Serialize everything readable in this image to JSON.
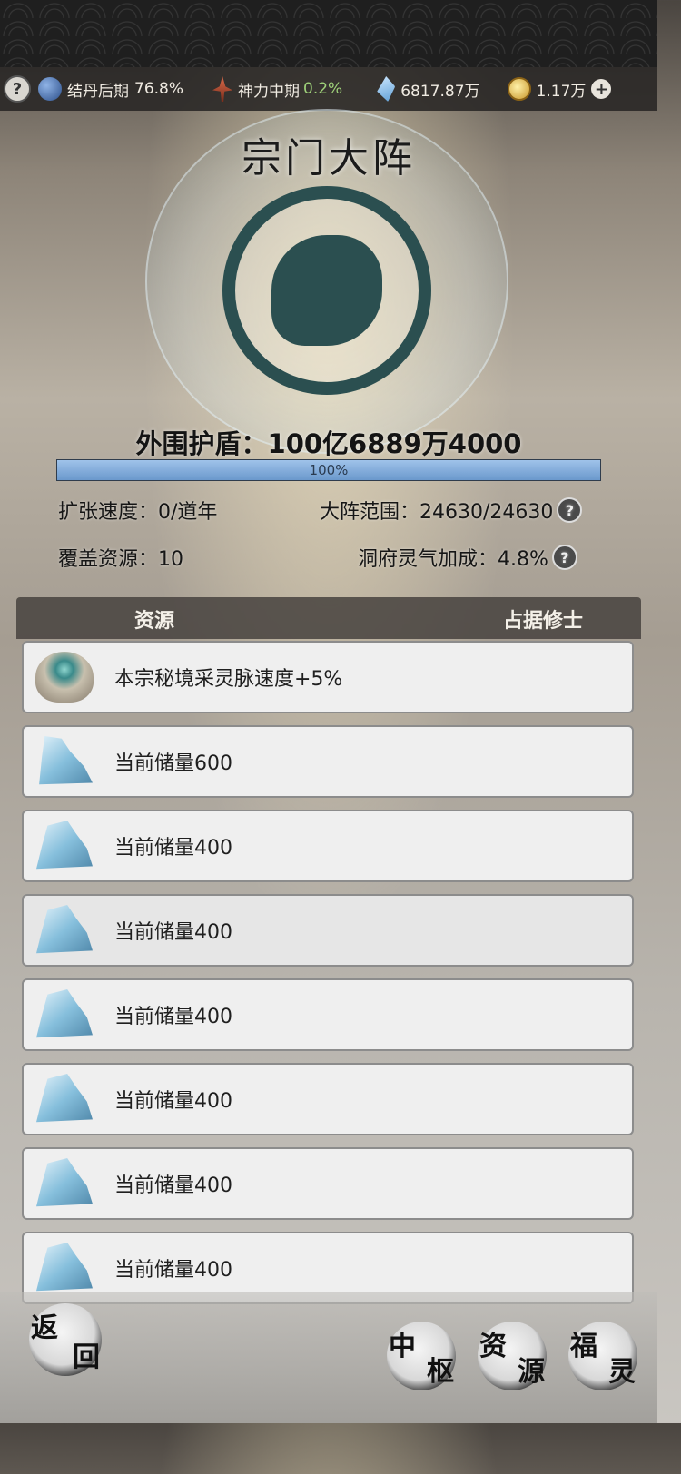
{
  "resource_bar": {
    "help_icon": "?",
    "realm_label": "结丹后期",
    "realm_pct": "76.8%",
    "divine_label": "神力中期",
    "divine_pct": "0.2%",
    "spirit_stones": "6817.87万",
    "gold": "1.17万",
    "plus_icon": "+"
  },
  "title": "宗门大阵",
  "shield": {
    "label": "外围护盾：100亿6889万4000",
    "progress_text": "100%",
    "progress": 1.0
  },
  "stats": {
    "expand_speed": "扩张速度：0/道年",
    "range": "大阵范围：24630/24630",
    "coverage": "覆盖资源：10",
    "aura_bonus": "洞府灵气加成：4.8%",
    "help_icon": "?"
  },
  "table": {
    "col_resource": "资源",
    "col_occupier": "占据修士"
  },
  "rows": [
    {
      "text": "本宗秘境采灵脉速度+5%",
      "icon": "spirit-creature-icon"
    },
    {
      "text": "当前储量600",
      "icon": "ore-crystal-icon"
    },
    {
      "text": "当前储量400",
      "icon": "ore-crystal-icon"
    },
    {
      "text": "当前储量400",
      "icon": "ore-crystal-icon"
    },
    {
      "text": "当前储量400",
      "icon": "ore-crystal-icon"
    },
    {
      "text": "当前储量400",
      "icon": "ore-crystal-icon"
    },
    {
      "text": "当前储量400",
      "icon": "ore-crystal-icon"
    },
    {
      "text": "当前储量400",
      "icon": "ore-crystal-icon"
    }
  ],
  "bottom": {
    "back": [
      "返",
      "回"
    ],
    "center": [
      "中",
      "枢"
    ],
    "resources": [
      "资",
      "源"
    ],
    "blessing": [
      "福",
      "灵"
    ]
  }
}
